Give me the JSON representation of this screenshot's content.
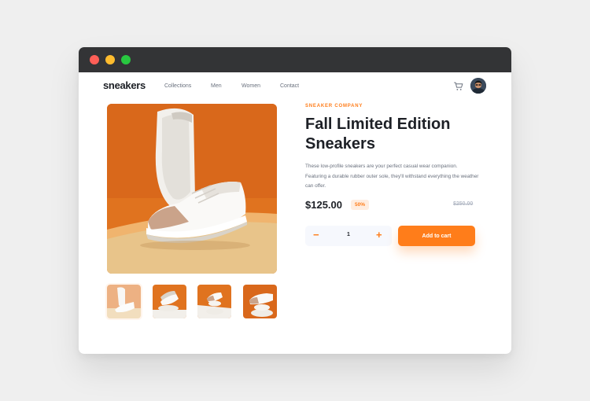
{
  "brand": {
    "logo": "sneakers",
    "accent_color": "#ff7d1a",
    "accent_light": "#ffede0",
    "text_dark": "#1d2026",
    "text_muted": "#69707d"
  },
  "nav": {
    "links": [
      "Collections",
      "Men",
      "Women",
      "Contact"
    ],
    "cart_icon": "cart-icon",
    "avatar_icon": "avatar"
  },
  "product": {
    "company": "SNEAKER COMPANY",
    "title": "Fall Limited Edition Sneakers",
    "description": "These low-profile sneakers are your perfect casual wear companion. Featuring a durable rubber outer sole, they'll withstand everything the weather can offer.",
    "price": "$125.00",
    "discount": "50%",
    "original_price": "$250.00"
  },
  "cart": {
    "minus_label": "−",
    "quantity": "1",
    "plus_label": "+",
    "add_to_cart_label": "Add to cart"
  }
}
